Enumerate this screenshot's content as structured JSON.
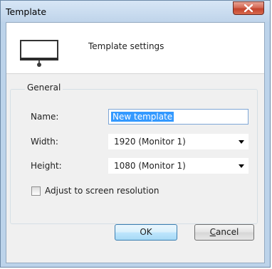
{
  "window": {
    "title": "Template",
    "close_label": "X"
  },
  "header": {
    "title": "Template settings",
    "icon": "monitor-screen-icon"
  },
  "general": {
    "legend": "General",
    "name_label": "Name:",
    "name_value": "New template",
    "width_label": "Width:",
    "width_value": "1920 (Monitor 1)",
    "height_label": "Height:",
    "height_value": "1080 (Monitor 1)",
    "adjust_label": "Adjust to screen resolution",
    "adjust_checked": false
  },
  "buttons": {
    "ok": "OK",
    "cancel": "Cancel",
    "cancel_accelerator": "C",
    "cancel_rest": "ancel"
  },
  "colors": {
    "selection": "#3399ff",
    "close_button": "#c3432c",
    "focus_border": "#7ea6d6"
  }
}
